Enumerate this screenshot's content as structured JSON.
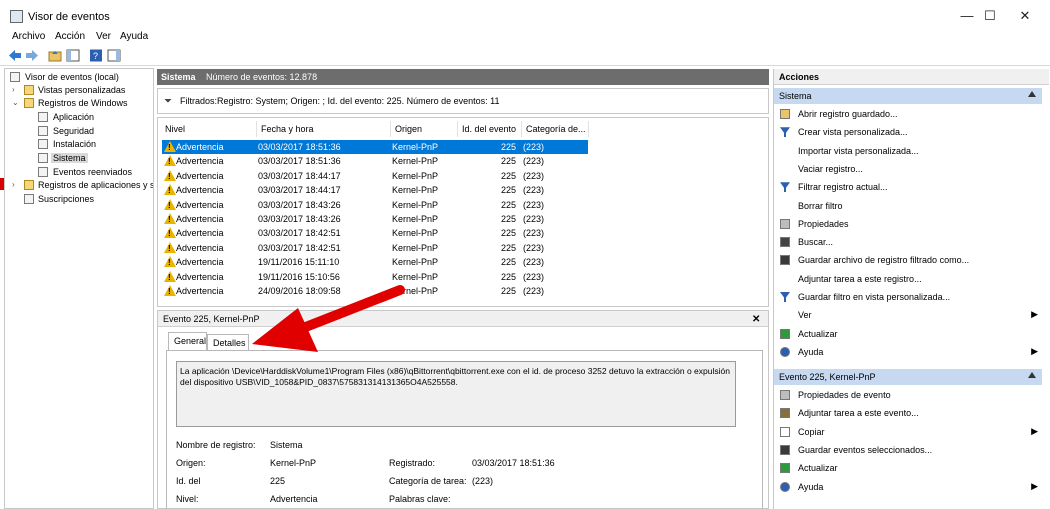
{
  "window": {
    "title": "Visor de eventos",
    "minimize": "—",
    "maximize": "☐",
    "close": "✕"
  },
  "menu": [
    "Archivo",
    "Acción",
    "Ver",
    "Ayuda"
  ],
  "tree": {
    "items": [
      {
        "label": "Visor de eventos (local)",
        "expander": "",
        "icon": "event-viewer-icon",
        "level": 0
      },
      {
        "label": "Vistas personalizadas",
        "expander": "›",
        "icon": "folder-icon",
        "level": 1
      },
      {
        "label": "Registros de Windows",
        "expander": "⌄",
        "icon": "folder-icon",
        "level": 1
      },
      {
        "label": "Aplicación",
        "expander": "",
        "icon": "log-icon",
        "level": 2
      },
      {
        "label": "Seguridad",
        "expander": "",
        "icon": "log-icon",
        "level": 2
      },
      {
        "label": "Instalación",
        "expander": "",
        "icon": "log-icon",
        "level": 2
      },
      {
        "label": "Sistema",
        "expander": "",
        "icon": "log-icon",
        "level": 2,
        "selected": true
      },
      {
        "label": "Eventos reenviados",
        "expander": "",
        "icon": "log-icon",
        "level": 2
      },
      {
        "label": "Registros de aplicaciones y s",
        "expander": "›",
        "icon": "folder-icon",
        "level": 1
      },
      {
        "label": "Suscripciones",
        "expander": "",
        "icon": "subscription-icon",
        "level": 1
      }
    ]
  },
  "center": {
    "log_name": "Sistema",
    "event_count": "Número de eventos: 12.878",
    "filter_text": "Filtrados:Registro: System; Origen: ; Id. del evento: 225. Número de eventos: 11"
  },
  "grid": {
    "columns": [
      "Nivel",
      "Fecha y hora",
      "Origen",
      "Id. del evento",
      "Categoría de..."
    ],
    "rows": [
      [
        "Advertencia",
        "03/03/2017 18:51:36",
        "Kernel-PnP",
        "225",
        "(223)"
      ],
      [
        "Advertencia",
        "03/03/2017 18:51:36",
        "Kernel-PnP",
        "225",
        "(223)"
      ],
      [
        "Advertencia",
        "03/03/2017 18:44:17",
        "Kernel-PnP",
        "225",
        "(223)"
      ],
      [
        "Advertencia",
        "03/03/2017 18:44:17",
        "Kernel-PnP",
        "225",
        "(223)"
      ],
      [
        "Advertencia",
        "03/03/2017 18:43:26",
        "Kernel-PnP",
        "225",
        "(223)"
      ],
      [
        "Advertencia",
        "03/03/2017 18:43:26",
        "Kernel-PnP",
        "225",
        "(223)"
      ],
      [
        "Advertencia",
        "03/03/2017 18:42:51",
        "Kernel-PnP",
        "225",
        "(223)"
      ],
      [
        "Advertencia",
        "03/03/2017 18:42:51",
        "Kernel-PnP",
        "225",
        "(223)"
      ],
      [
        "Advertencia",
        "19/11/2016 15:11:10",
        "Kernel-PnP",
        "225",
        "(223)"
      ],
      [
        "Advertencia",
        "19/11/2016 15:10:56",
        "Kernel-PnP",
        "225",
        "(223)"
      ],
      [
        "Advertencia",
        "24/09/2016 18:09:58",
        "Kernel-PnP",
        "225",
        "(223)"
      ]
    ],
    "selected_row": 0
  },
  "detail": {
    "title": "Evento 225, Kernel-PnP",
    "close": "✕",
    "tabs": [
      "General",
      "Detalles"
    ],
    "message": "La aplicación \\Device\\HarddiskVolume1\\Program Files (x86)\\qBittorrent\\qbittorrent.exe con el id. de proceso 3252 detuvo la extracción o expulsión del dispositivo USB\\VID_1058&PID_0837\\575831314131365O4A525558.",
    "fields": {
      "log_name_label": "Nombre de registro:",
      "log_name_value": "Sistema",
      "source_label": "Origen:",
      "source_value": "Kernel-PnP",
      "logged_label": "Registrado:",
      "logged_value": "03/03/2017 18:51:36",
      "event_id_label": "Id. del",
      "event_id_value": "225",
      "task_label": "Categoría de tarea:",
      "task_value": "(223)",
      "level_label": "Nivel:",
      "level_value": "Advertencia",
      "keywords_label": "Palabras clave:"
    }
  },
  "actions": {
    "header": "Acciones",
    "section1": "Sistema",
    "items1": [
      {
        "label": "Abrir registro guardado...",
        "icon": "open-folder-icon"
      },
      {
        "label": "Crear vista personalizada...",
        "icon": "filter-icon"
      },
      {
        "label": "Importar vista personalizada...",
        "icon": ""
      },
      {
        "label": "Vaciar registro...",
        "icon": ""
      },
      {
        "label": "Filtrar registro actual...",
        "icon": "filter-icon"
      },
      {
        "label": "Borrar filtro",
        "icon": ""
      },
      {
        "label": "Propiedades",
        "icon": "properties-icon"
      },
      {
        "label": "Buscar...",
        "icon": "binoculars-icon"
      },
      {
        "label": "Guardar archivo de registro filtrado como...",
        "icon": "save-icon"
      },
      {
        "label": "Adjuntar tarea a este registro...",
        "icon": ""
      },
      {
        "label": "Guardar filtro en vista personalizada...",
        "icon": "filter-icon"
      },
      {
        "label": "Ver",
        "icon": "",
        "submenu": "▶"
      },
      {
        "label": "Actualizar",
        "icon": "refresh-icon"
      },
      {
        "label": "Ayuda",
        "icon": "help-icon",
        "submenu": "▶"
      }
    ],
    "section2": "Evento 225, Kernel-PnP",
    "items2": [
      {
        "label": "Propiedades de evento",
        "icon": "properties-icon"
      },
      {
        "label": "Adjuntar tarea a este evento...",
        "icon": "task-icon"
      },
      {
        "label": "Copiar",
        "icon": "copy-icon",
        "submenu": "▶"
      },
      {
        "label": "Guardar eventos seleccionados...",
        "icon": "save-icon"
      },
      {
        "label": "Actualizar",
        "icon": "refresh-icon"
      },
      {
        "label": "Ayuda",
        "icon": "help-icon",
        "submenu": "▶"
      }
    ]
  },
  "colors": {
    "accent": "#0078d7",
    "section": "#c6d9f0",
    "arrow": "#e00000",
    "warning": "#e8b400"
  }
}
